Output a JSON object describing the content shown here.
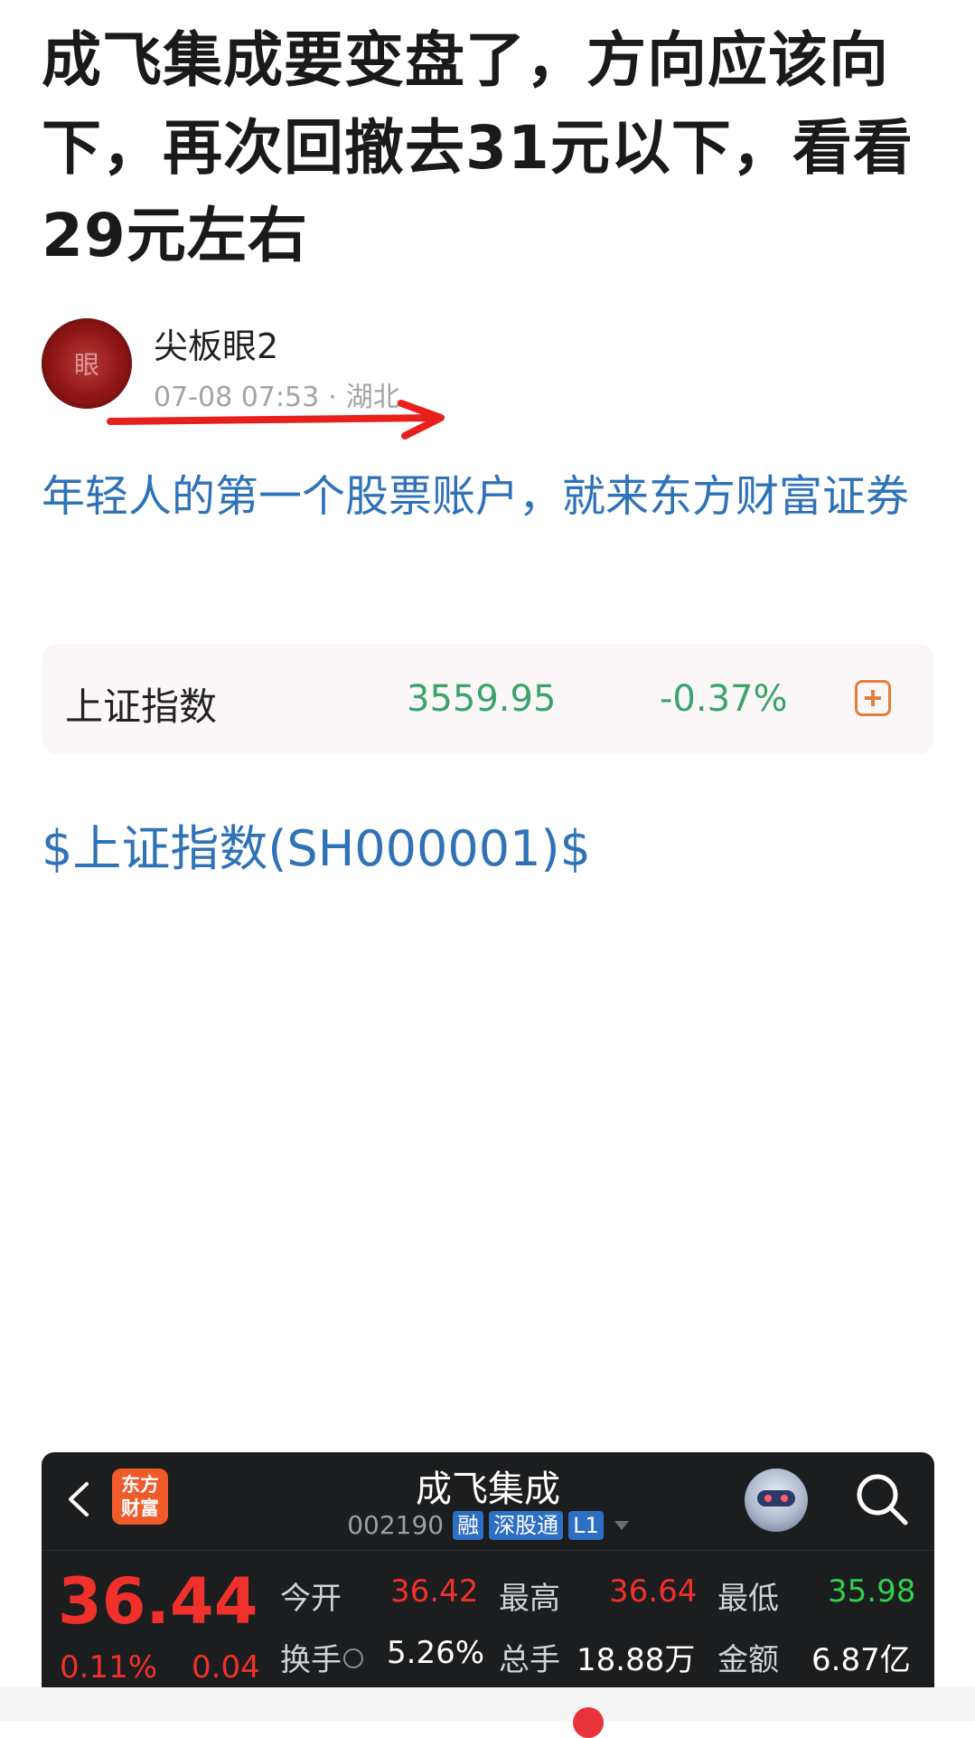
{
  "post": {
    "title": "成飞集成要变盘了，方向应该向下，再次回撤去31元以下，看看29元左右",
    "author": {
      "avatar_text": "眼",
      "name": "尖板眼2",
      "time": "07-08 07:53",
      "separator": "·",
      "location": "湖北"
    },
    "ad_text": "年轻人的第一个股票账户，就来东方财富证券",
    "quote_card": {
      "name": "上证指数",
      "price": "3559.95",
      "change": "-0.37%"
    },
    "stock_link": "$上证指数(SH000001)$"
  },
  "stock_panel": {
    "logo_line1": "东方",
    "logo_line2": "财富",
    "title": "成飞集成",
    "code": "002190",
    "tags": [
      "融",
      "深股通",
      "L1"
    ],
    "price": "36.44",
    "change_pct": "0.11%",
    "change_abs": "0.04",
    "stats": {
      "open_label": "今开",
      "open": "36.42",
      "high_label": "最高",
      "high": "36.64",
      "low_label": "最低",
      "low": "35.98",
      "turnover_label": "换手",
      "turnover": "5.26%",
      "volume_label": "总手",
      "volume": "18.88万",
      "amount_label": "金额",
      "amount": "6.87亿"
    }
  },
  "colors": {
    "link_blue": "#2f72b8",
    "down_green": "#3aa46a",
    "up_red": "#f0312b",
    "annotation_arrow": "#e8201c"
  },
  "icons": [
    "back-icon",
    "search-icon",
    "add-icon",
    "info-icon",
    "robot-assistant-icon",
    "dropdown-caret-icon"
  ]
}
